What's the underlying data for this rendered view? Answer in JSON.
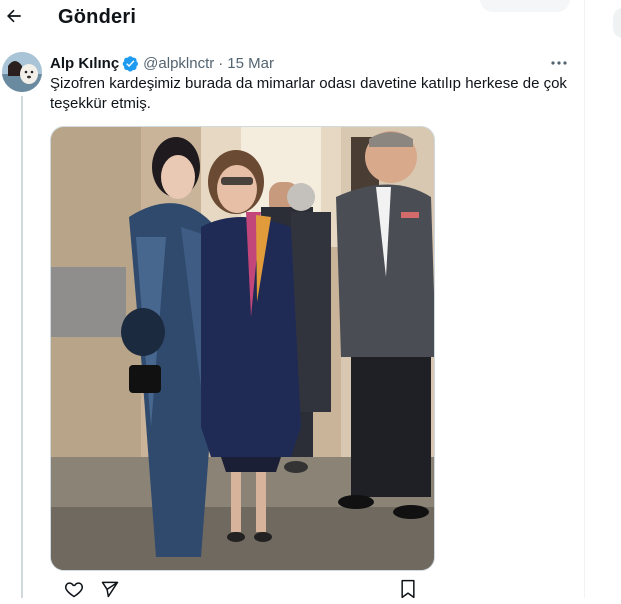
{
  "header": {
    "title": "Gönderi",
    "back_icon": "arrow-left-icon"
  },
  "tweet": {
    "author": {
      "name": "Alp Kılınç",
      "handle": "@alpklnctr",
      "verified": true,
      "verified_color": "#1d9bf0"
    },
    "separator": "·",
    "date": "15 Mar",
    "text": "Şizofren kardeşimiz burada da mimarlar odası davetine katılıp herkese de çok teşekkür etmiş.",
    "media": {
      "kind": "photo"
    },
    "actions": [
      {
        "icon": "heart-icon"
      },
      {
        "icon": "share-icon"
      },
      {
        "icon": "bookmark-icon"
      }
    ]
  },
  "colors": {
    "text": "#0f1419",
    "secondary": "#536471",
    "accent": "#1d9bf0",
    "border": "#cfd9de"
  }
}
